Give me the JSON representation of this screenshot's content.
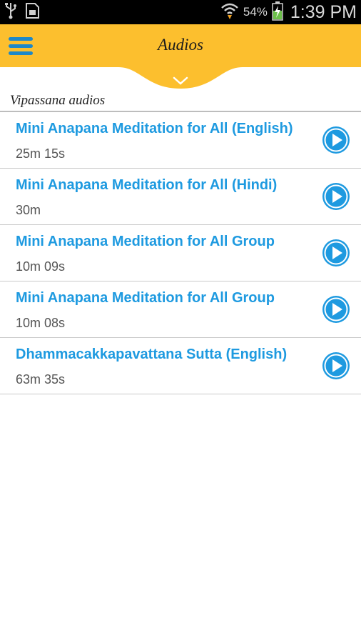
{
  "status_bar": {
    "battery_percent": "54%",
    "time": "1:39 PM",
    "icons": [
      "usb-icon",
      "sim-card-icon",
      "wifi-icon",
      "battery-charging-icon"
    ]
  },
  "header": {
    "title": "Audios",
    "accent_color": "#fcbf2e",
    "menu_icon": "hamburger-menu-icon",
    "expand_icon": "chevron-down-icon"
  },
  "section": {
    "label": "Vipassana audios"
  },
  "audios": [
    {
      "title": "Mini Anapana Meditation for All (English)",
      "duration": "25m 15s"
    },
    {
      "title": "Mini Anapana Meditation for All (Hindi)",
      "duration": "30m"
    },
    {
      "title": "Mini Anapana Meditation for All Group",
      "duration": "10m 09s"
    },
    {
      "title": "Mini Anapana Meditation for All Group",
      "duration": "10m 08s"
    },
    {
      "title": "Dhammacakkapavattana Sutta (English)",
      "duration": "63m 35s"
    }
  ],
  "colors": {
    "title_blue": "#1e9ae0",
    "play_button_blue": "#1e9ae0"
  }
}
